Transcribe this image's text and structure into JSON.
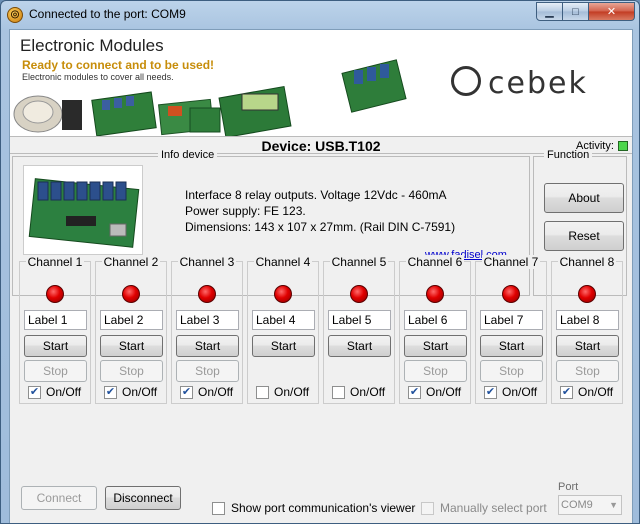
{
  "window": {
    "title": "Connected to the port: COM9"
  },
  "banner": {
    "title": "Electronic Modules",
    "subtitle": "Ready to connect and to be used!",
    "tagline": "Electronic modules to cover all needs.",
    "logo": "cebek"
  },
  "device": {
    "label": "Device: USB.T102",
    "activity_label": "Activity:"
  },
  "info": {
    "group_title": "Info device",
    "lines": [
      "Interface 8 relay outputs.   Voltage 12Vdc - 460mA",
      "Power supply: FE 123.",
      "Dimensions: 143 x 107 x 27mm. (Rail DIN C-7591)"
    ],
    "link": "www.fadisel.com"
  },
  "function": {
    "group_title": "Function",
    "about": "About",
    "reset": "Reset"
  },
  "channels": [
    {
      "title": "Channel 1",
      "label": "Label 1",
      "start": "Start",
      "stop": "Stop",
      "onoff": "On/Off",
      "checked": true
    },
    {
      "title": "Channel 2",
      "label": "Label 2",
      "start": "Start",
      "stop": "Stop",
      "onoff": "On/Off",
      "checked": true
    },
    {
      "title": "Channel 3",
      "label": "Label 3",
      "start": "Start",
      "stop": "Stop",
      "onoff": "On/Off",
      "checked": true
    },
    {
      "title": "Channel 4",
      "label": "Label 4",
      "start": "Start",
      "stop": "",
      "onoff": "On/Off",
      "checked": false
    },
    {
      "title": "Channel 5",
      "label": "Label 5",
      "start": "Start",
      "stop": "",
      "onoff": "On/Off",
      "checked": false
    },
    {
      "title": "Channel 6",
      "label": "Label 6",
      "start": "Start",
      "stop": "Stop",
      "onoff": "On/Off",
      "checked": true
    },
    {
      "title": "Channel 7",
      "label": "Label 7",
      "start": "Start",
      "stop": "Stop",
      "onoff": "On/Off",
      "checked": true
    },
    {
      "title": "Channel 8",
      "label": "Label 8",
      "start": "Start",
      "stop": "Stop",
      "onoff": "On/Off",
      "checked": true
    }
  ],
  "bottom": {
    "connect": "Connect",
    "disconnect": "Disconnect",
    "show_viewer": "Show port communication's viewer",
    "manual_port": "Manually select port",
    "port_label": "Port",
    "port_value": "COM9"
  }
}
